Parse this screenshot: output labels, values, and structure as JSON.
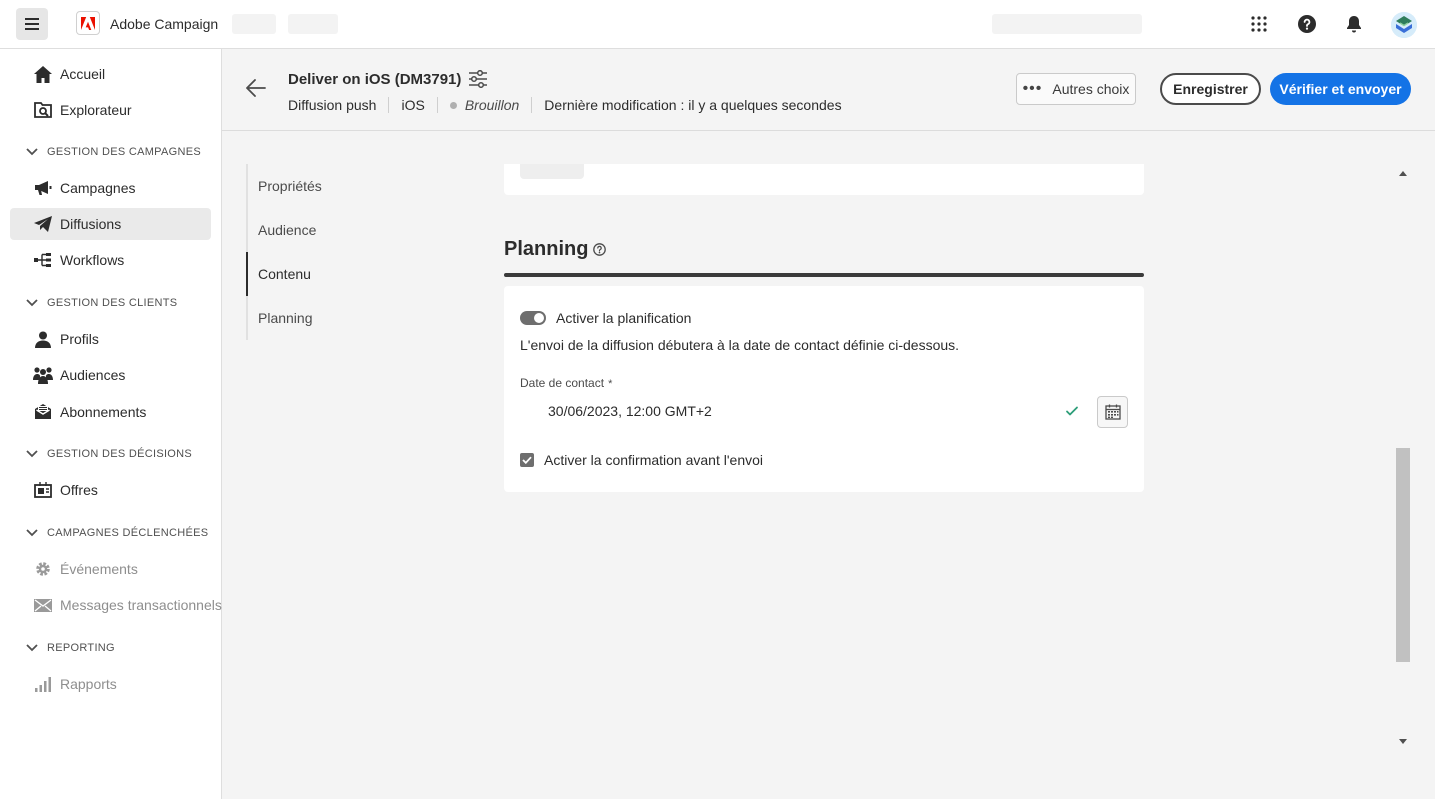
{
  "app": {
    "brand": "Adobe Campaign"
  },
  "sidebar": {
    "items": [
      {
        "label": "Accueil",
        "icon": "home-icon"
      },
      {
        "label": "Explorateur",
        "icon": "explorer-icon"
      }
    ],
    "sections": [
      {
        "label": "GESTION DES CAMPAGNES",
        "items": [
          {
            "label": "Campagnes",
            "icon": "megaphone-icon"
          },
          {
            "label": "Diffusions",
            "icon": "send-icon",
            "active": true
          },
          {
            "label": "Workflows",
            "icon": "workflow-icon"
          }
        ]
      },
      {
        "label": "GESTION DES CLIENTS",
        "items": [
          {
            "label": "Profils",
            "icon": "user-icon"
          },
          {
            "label": "Audiences",
            "icon": "users-icon"
          },
          {
            "label": "Abonnements",
            "icon": "mail-icon"
          }
        ]
      },
      {
        "label": "GESTION DES DÉCISIONS",
        "items": [
          {
            "label": "Offres",
            "icon": "offer-icon"
          }
        ]
      },
      {
        "label": "CAMPAGNES DÉCLENCHÉES",
        "items": [
          {
            "label": "Événements",
            "icon": "gear-icon",
            "disabled": true
          },
          {
            "label": "Messages transactionnels",
            "icon": "mail-icon",
            "disabled": true
          }
        ]
      },
      {
        "label": "REPORTING",
        "items": [
          {
            "label": "Rapports",
            "icon": "bar-chart-icon",
            "disabled": true
          }
        ]
      }
    ]
  },
  "header": {
    "title": "Deliver on iOS (DM3791)",
    "channel": "Diffusion push",
    "platform": "iOS",
    "status": "Brouillon",
    "modified": "Dernière modification : il y a quelques secondes",
    "more_label": "Autres choix",
    "save_label": "Enregistrer",
    "send_label": "Vérifier et envoyer"
  },
  "tabs": [
    {
      "label": "Propriétés"
    },
    {
      "label": "Audience"
    },
    {
      "label": "Contenu",
      "active": true
    },
    {
      "label": "Planning"
    }
  ],
  "planning": {
    "title": "Planning",
    "toggle_label": "Activer la planification",
    "toggle_on": true,
    "description": "L'envoi de la diffusion débutera à la date de contact définie ci-dessous.",
    "date_label": "Date de contact",
    "required_mark": "*",
    "date_value": "30/06/2023, 12:00 GMT+2",
    "confirm_label": "Activer la confirmation avant l'envoi",
    "confirm_checked": true
  },
  "colors": {
    "accent": "#1473e6",
    "brand_red": "#eb1000",
    "valid": "#2d9d78"
  }
}
